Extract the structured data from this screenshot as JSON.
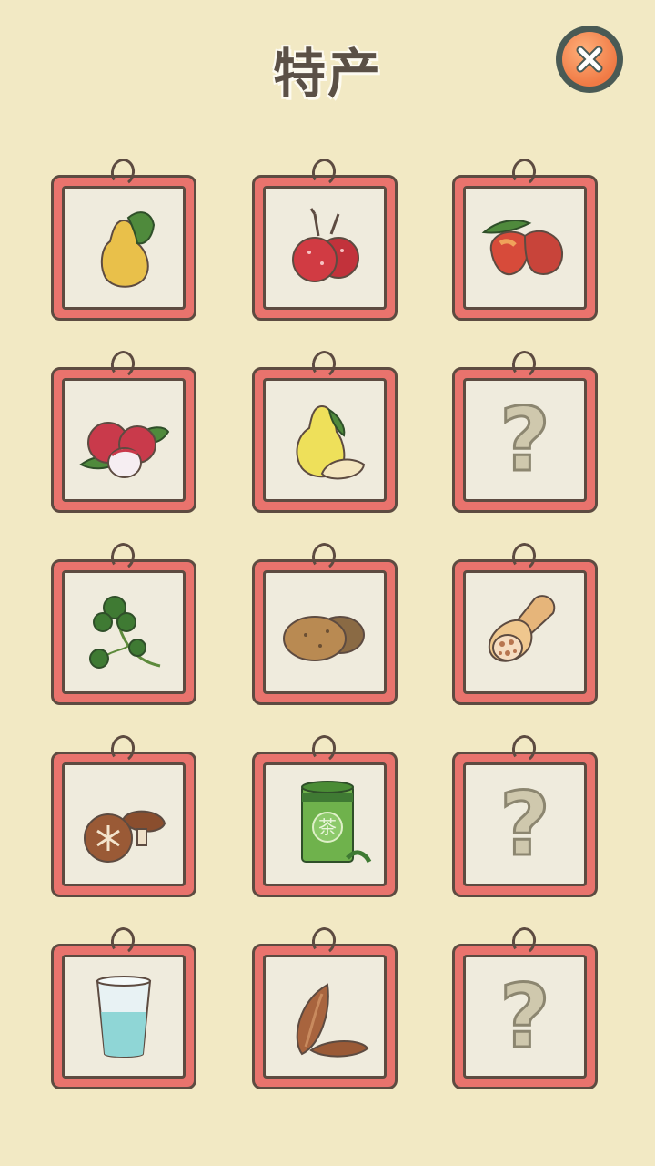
{
  "header": {
    "title": "特产"
  },
  "close_icon": "close-x-icon",
  "cards": [
    {
      "icon": "pear-icon",
      "locked": false
    },
    {
      "icon": "hawthorn-icon",
      "locked": false
    },
    {
      "icon": "jujube-icon",
      "locked": false
    },
    {
      "icon": "lychee-icon",
      "locked": false
    },
    {
      "icon": "pomelo-icon",
      "locked": false
    },
    {
      "icon": "question-mark-icon",
      "locked": true,
      "text": "?"
    },
    {
      "icon": "cilantro-icon",
      "locked": false
    },
    {
      "icon": "potato-icon",
      "locked": false
    },
    {
      "icon": "lotus-root-icon",
      "locked": false
    },
    {
      "icon": "shiitake-mushroom-icon",
      "locked": false
    },
    {
      "icon": "tea-can-icon",
      "locked": false,
      "text": "茶"
    },
    {
      "icon": "question-mark-icon",
      "locked": true,
      "text": "?"
    },
    {
      "icon": "water-glass-icon",
      "locked": false
    },
    {
      "icon": "almond-icon",
      "locked": false
    },
    {
      "icon": "question-mark-icon",
      "locked": true,
      "text": "?"
    }
  ],
  "colors": {
    "background": "#f2e9c4",
    "card_frame": "#e9736d",
    "card_inner": "#efebdd",
    "outline": "#5d4b41",
    "close_button": "#f07a45"
  }
}
